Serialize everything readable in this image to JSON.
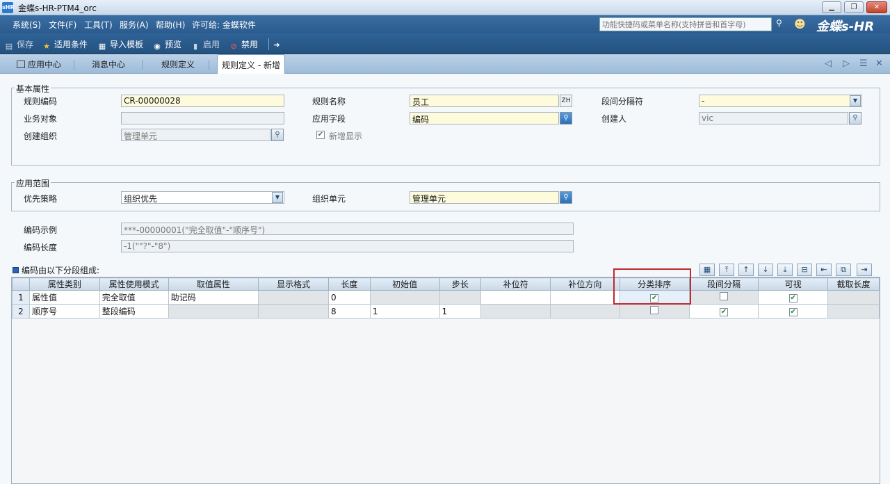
{
  "window": {
    "title": "金蝶s-HR-PTM4_orc",
    "app_icon": "sHR"
  },
  "menubar": {
    "items": [
      "系统(S)",
      "文件(F)",
      "工具(T)",
      "服务(A)",
      "帮助(H)",
      "许可给: 金蝶软件"
    ],
    "search_placeholder": "功能快捷码或菜单名称(支持拼音和首字母)",
    "brand": "金蝶s-HR"
  },
  "toolbar": {
    "save": "保存",
    "applicable_conditions": "适用条件",
    "import_template": "导入模板",
    "preview": "预览",
    "enable": "启用",
    "disable": "禁用"
  },
  "tabs": [
    "应用中心",
    "消息中心",
    "规则定义",
    "规则定义 - 新增"
  ],
  "basic": {
    "legend": "基本属性",
    "rule_code_label": "规则编码",
    "rule_code_value": "CR-00000028",
    "rule_name_label": "规则名称",
    "rule_name_value": "员工",
    "zh": "ZH",
    "separator_label": "段间分隔符",
    "separator_value": "-",
    "business_object_label": "业务对象",
    "business_object_value": "",
    "apply_field_label": "应用字段",
    "apply_field_value": "编码",
    "creator_label": "创建人",
    "creator_value": "vic",
    "create_org_label": "创建组织",
    "create_org_value": "管理单元",
    "new_display_label": "新增显示"
  },
  "scope": {
    "legend": "应用范围",
    "priority_label": "优先策略",
    "priority_value": "组织优先",
    "org_unit_label": "组织单元",
    "org_unit_value": "管理单元"
  },
  "code_example_label": "编码示例",
  "code_example_value": "***-00000001(\"完全取值\"-\"顺序号\")",
  "code_length_label": "编码长度",
  "code_length_value": "-1(\"\"?\"-\"8\")",
  "segments_title": "编码由以下分段组成:",
  "grid": {
    "columns": [
      "属性类别",
      "属性使用模式",
      "取值属性",
      "显示格式",
      "长度",
      "初始值",
      "步长",
      "补位符",
      "补位方向",
      "分类排序",
      "段间分隔",
      "可视",
      "截取长度"
    ],
    "rows": [
      {
        "no": "1",
        "type": "属性值",
        "mode": "完全取值",
        "value_attr": "助记码",
        "format": "",
        "length": "0",
        "init": "",
        "step": "",
        "pad": "",
        "pad_dir": "",
        "sort": true,
        "sep": false,
        "visible": true,
        "cut": ""
      },
      {
        "no": "2",
        "type": "顺序号",
        "mode": "整段编码",
        "value_attr": "",
        "format": "",
        "length": "8",
        "init": "1",
        "step": "1",
        "pad": "",
        "pad_dir": "",
        "sort": false,
        "sep": true,
        "visible": true,
        "cut": ""
      }
    ]
  }
}
